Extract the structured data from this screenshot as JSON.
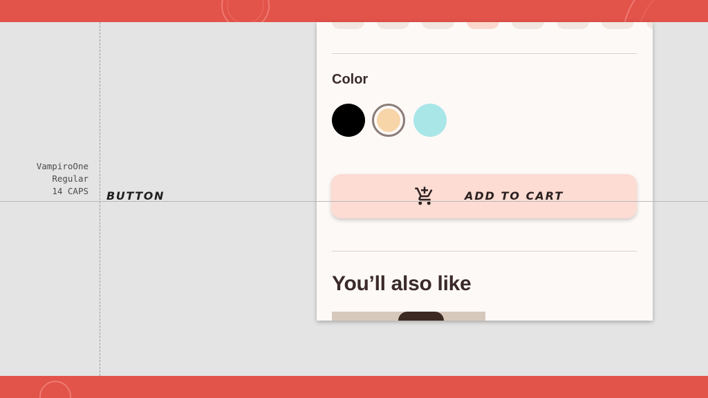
{
  "spec": {
    "font_name": "VampiroOne",
    "font_weight": "Regular",
    "font_size_case": "14 CAPS",
    "style_name": "BUTTON"
  },
  "product": {
    "color_section": {
      "label": "Color",
      "swatches": [
        {
          "name": "black",
          "hex": "#000000",
          "selected": false
        },
        {
          "name": "peach",
          "hex": "#f7d5a8",
          "selected": true
        },
        {
          "name": "cyan",
          "hex": "#a8e6e8",
          "selected": false
        }
      ]
    },
    "add_to_cart": {
      "label": "ADD TO CART",
      "icon": "add-shopping-cart-icon"
    },
    "recommendations": {
      "heading": "You’ll also like"
    }
  },
  "colors": {
    "brand_band": "#e2534a",
    "button_bg": "#fcdcd3",
    "surface": "#fdf9f7",
    "text_primary": "#3a2a2a"
  }
}
